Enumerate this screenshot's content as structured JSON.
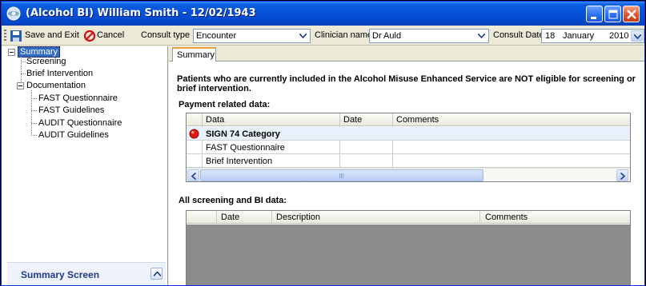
{
  "window": {
    "title": "(Alcohol BI) William Smith - 12/02/1943",
    "accent": "#0550d8"
  },
  "toolbar": {
    "save_label": "Save and Exit",
    "cancel_label": "Cancel",
    "consult_type_label": "Consult type",
    "consult_type_value": "Encounter",
    "clinician_label": "Clinician name",
    "clinician_value": "Dr Auld",
    "consult_date_label": "Consult Date",
    "consult_date_day": "18",
    "consult_date_month": "January",
    "consult_date_year": "2010"
  },
  "tree": {
    "root": "Summary",
    "screening": "Screening",
    "brief_intervention": "Brief Intervention",
    "documentation": "Documentation",
    "fast_questionnaire": "FAST Questionnaire",
    "fast_guidelines": "FAST Guidelines",
    "audit_questionnaire": "AUDIT Questionnaire",
    "audit_guidelines": "AUDIT Guidelines"
  },
  "summary_screen": {
    "label": "Summary Screen"
  },
  "main": {
    "tab": "Summary",
    "warning": "Patients who are currently included in the Alcohol Misuse Enhanced Service are NOT eligible for screening or brief intervention.",
    "payment_title": "Payment related data:",
    "payment_columns": [
      "Data",
      "Date",
      "Comments"
    ],
    "payment_rows": [
      {
        "data": "SIGN 74 Category",
        "date": "",
        "comments": "",
        "status": "red"
      },
      {
        "data": "FAST Questionnaire",
        "date": "",
        "comments": "",
        "status": ""
      },
      {
        "data": "Brief Intervention",
        "date": "",
        "comments": "",
        "status": ""
      }
    ],
    "screening_title": "All screening and BI data:",
    "screening_columns": [
      "Date",
      "Description",
      "Comments"
    ]
  }
}
